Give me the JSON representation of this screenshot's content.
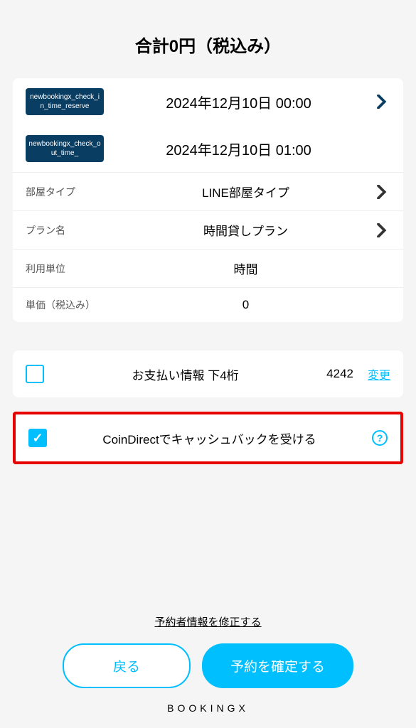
{
  "total_label": "合計0円（税込み）",
  "details": {
    "checkin": {
      "badge": "newbookingx_check_in_time_reserve",
      "value": "2024年12月10日 00:00"
    },
    "checkout": {
      "badge": "newbookingx_check_out_time_",
      "value": "2024年12月10日 01:00"
    },
    "room_type": {
      "label": "部屋タイプ",
      "value": "LINE部屋タイプ"
    },
    "plan": {
      "label": "プラン名",
      "value": "時間貸しプラン"
    },
    "unit": {
      "label": "利用単位",
      "value": "時間"
    },
    "price": {
      "label": "単価（税込み）",
      "value": "0"
    }
  },
  "payment": {
    "label": "お支払い情報 下4桁",
    "digits": "4242",
    "change": "変更"
  },
  "cashback": {
    "label": "CoinDirectでキャッシュバックを受ける"
  },
  "footer": {
    "edit_link": "予約者情報を修正する",
    "back": "戻る",
    "confirm": "予約を確定する",
    "brand": "BOOKINGX"
  }
}
